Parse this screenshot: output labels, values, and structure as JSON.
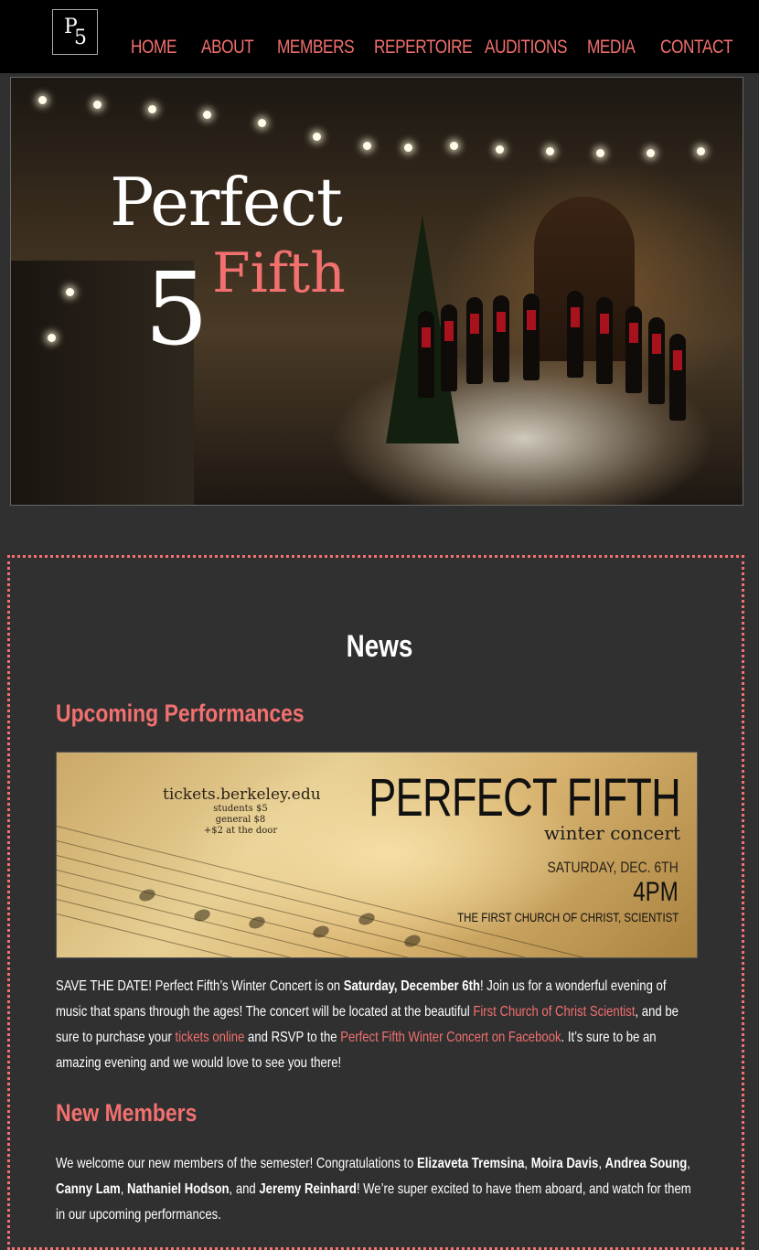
{
  "logo": {
    "letter_p": "P",
    "letter_5": "5"
  },
  "nav": {
    "items": [
      "HOME",
      "ABOUT",
      "MEMBERS",
      "REPERTOIRE",
      "AUDITIONS",
      "MEDIA",
      "CONTACT"
    ]
  },
  "hero": {
    "title_perfect": "Perfect",
    "title_5": "5",
    "title_fifth": "Fifth"
  },
  "news": {
    "heading": "News",
    "upcoming_heading": "Upcoming Performances",
    "banner": {
      "tickets": "tickets.berkeley.edu",
      "students": "students $5",
      "general": "general $8",
      "door": "+$2 at the door",
      "title": "PERFECT FIFTH",
      "subtitle": "winter concert",
      "date": "SATURDAY, DEC. 6TH",
      "time": "4PM",
      "venue": "THE FIRST CHURCH OF CHRIST, SCIENTIST"
    },
    "para1": {
      "t1": "SAVE THE DATE! Perfect Fifth’s Winter Concert is on ",
      "b1": "Saturday, December 6th",
      "t2": "! Join us for a wonderful evening of music that spans through the ages! The concert will be located at the beautiful ",
      "link1": "First Church of Christ Scientist",
      "t3": ", and be sure to purchase your ",
      "link2": "tickets online",
      "t4": " and RSVP to the ",
      "link3": "Perfect Fifth Winter Concert on Facebook",
      "t5": ". It’s sure to be an amazing evening and we would love to see you there!"
    },
    "new_members_heading": "New Members",
    "para2": {
      "t1": "We welcome our new members of the semester! Congratulations to ",
      "n1": "Elizaveta Tremsina",
      "s1": ", ",
      "n2": "Moira Davis",
      "s2": ", ",
      "n3": "Andrea Soung",
      "s3": ", ",
      "n4": "Canny Lam",
      "s4": ", ",
      "n5": "Nathaniel Hodson",
      "s5": ", and ",
      "n6": "Jeremy Reinhard",
      "t2": "! We’re super excited to have them aboard, and watch for them in our upcoming performances."
    }
  },
  "colors": {
    "accent": "#f2706f",
    "background": "#303030",
    "topbar": "#000000"
  }
}
